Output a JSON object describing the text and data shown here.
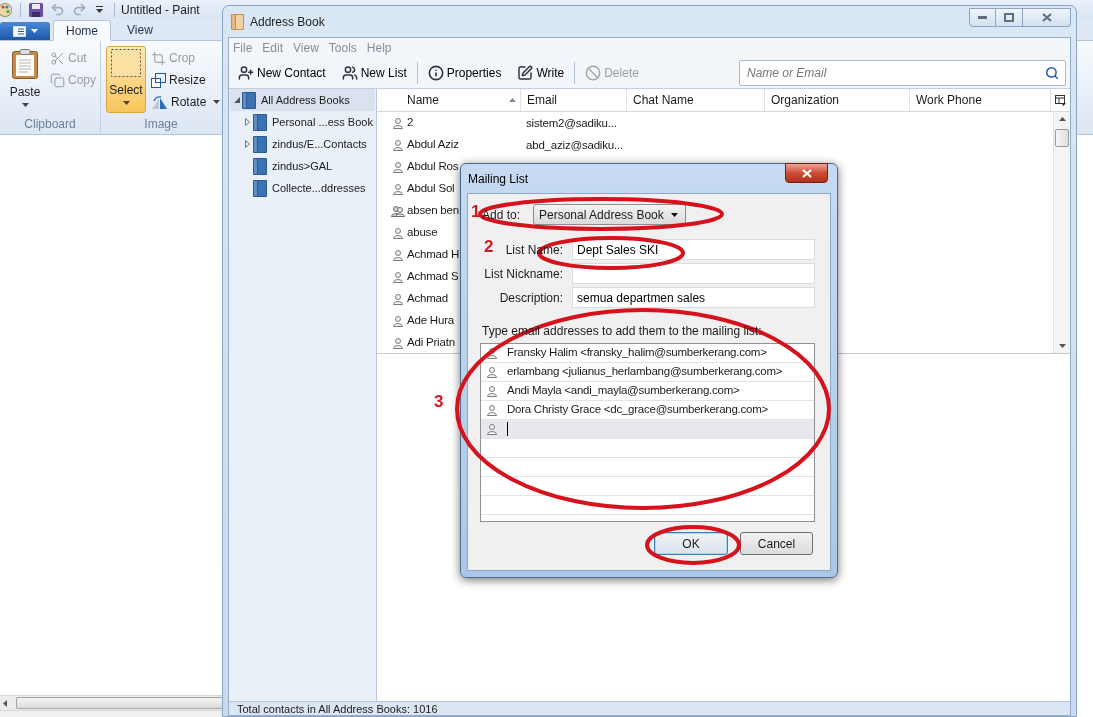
{
  "paint_window": {
    "title": "Untitled - Paint",
    "tabs": [
      {
        "label": "Home",
        "selected": true
      },
      {
        "label": "View",
        "selected": false
      }
    ],
    "groups": [
      {
        "label": "Clipboard",
        "items": [
          {
            "kind": "large",
            "label": "Paste",
            "menu": true,
            "disabled": false,
            "selected": false
          },
          {
            "kind": "small",
            "label": "Cut",
            "menu": false,
            "disabled": true,
            "selected": false
          },
          {
            "kind": "small",
            "label": "Copy",
            "menu": false,
            "disabled": true,
            "selected": false
          }
        ]
      },
      {
        "label": "Image",
        "items": [
          {
            "kind": "large",
            "label": "Select",
            "menu": true,
            "disabled": false,
            "selected": true
          },
          {
            "kind": "small",
            "label": "Crop",
            "menu": false,
            "disabled": true,
            "selected": false
          },
          {
            "kind": "small",
            "label": "Resize",
            "menu": false,
            "disabled": false,
            "selected": false
          },
          {
            "kind": "small",
            "label": "Rotate",
            "menu": true,
            "disabled": false,
            "selected": false
          }
        ]
      }
    ]
  },
  "address_book": {
    "title": "Address Book",
    "active": false,
    "menu": [
      "File",
      "Edit",
      "View",
      "Tools",
      "Help"
    ],
    "toolbar": [
      [
        {
          "label": "New Contact",
          "disabled": false
        },
        {
          "label": "New List",
          "disabled": false
        }
      ],
      [
        {
          "label": "Properties",
          "disabled": false
        },
        {
          "label": "Write",
          "disabled": false
        }
      ],
      [
        {
          "label": "Delete",
          "disabled": true
        }
      ]
    ],
    "search": {
      "placeholder": "Name or Email"
    },
    "tree": [
      {
        "label": "All Address Books",
        "selected": true,
        "expanded": true,
        "children": [
          {
            "label": "Personal ...ess Book",
            "selected": false,
            "expanded": false
          },
          {
            "label": "zindus/E...Contacts",
            "selected": false,
            "expanded": false
          },
          {
            "label": "zindus>GAL",
            "selected": false
          },
          {
            "label": "Collecte...ddresses",
            "selected": false
          }
        ]
      }
    ],
    "columns": [
      {
        "label": "Name",
        "sorted": true
      },
      {
        "label": "Email",
        "sorted": false
      },
      {
        "label": "Chat Name",
        "sorted": false
      },
      {
        "label": "Organization",
        "sorted": false
      },
      {
        "label": "Work Phone",
        "sorted": false
      }
    ],
    "rows": [
      {
        "kind": "contact",
        "name": "2",
        "email": "sistem2@sadiku..."
      },
      {
        "kind": "contact",
        "name": "Abdul Aziz",
        "email": "abd_aziz@sadiku..."
      },
      {
        "kind": "contact",
        "name": "Abdul Ros"
      },
      {
        "kind": "contact",
        "name": "Abdul Sol"
      },
      {
        "kind": "list",
        "name": "absen ben"
      },
      {
        "kind": "contact",
        "name": "abuse"
      },
      {
        "kind": "contact",
        "name": "Achmad H"
      },
      {
        "kind": "contact",
        "name": "Achmad S"
      },
      {
        "kind": "contact",
        "name": "Achmad"
      },
      {
        "kind": "contact",
        "name": "Ade Hura"
      },
      {
        "kind": "contact",
        "name": "Adi Priatn"
      }
    ],
    "status": "Total contacts in All Address Books: 1016"
  },
  "dialog": {
    "title": "Mailing List",
    "add_to": {
      "label": "Add to:",
      "value": "Personal Address Book"
    },
    "fields": [
      {
        "label": "List Name:",
        "value": "Dept Sales SKI"
      },
      {
        "label": "List Nickname:"
      },
      {
        "label": "Description:",
        "value": "semua departmen sales"
      }
    ],
    "instructions": "Type email addresses to add them to the mailing list:",
    "members": [
      "Fransky Halim <fransky_halim@sumberkerang.com>",
      "erlambang <julianus_herlambang@sumberkerang.com>",
      "Andi Mayla <andi_mayla@sumberkerang.com>",
      "Dora Christy Grace <dc_grace@sumberkerang.com>"
    ],
    "new_entry": {
      "focused": true
    },
    "buttons": [
      {
        "label": "OK",
        "default": true
      },
      {
        "label": "Cancel",
        "default": false
      }
    ]
  },
  "annotations": [
    "1",
    "2",
    "3"
  ]
}
